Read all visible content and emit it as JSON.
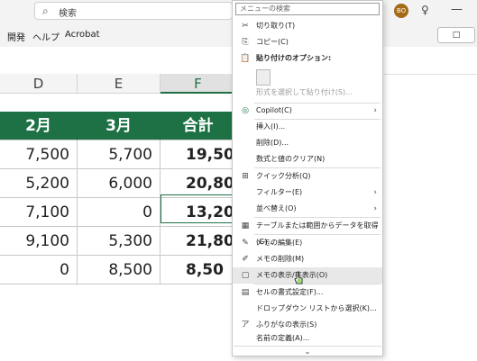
{
  "titlebar": {
    "search_placeholder": "検索",
    "avatar_initials": "BO"
  },
  "ribbon": {
    "tabs": [
      "開発",
      "ヘルプ",
      "Acrobat"
    ]
  },
  "comment_button": "□",
  "columns": [
    "D",
    "E",
    "F"
  ],
  "header_row": [
    "2月",
    "3月",
    "合計"
  ],
  "rows": [
    [
      "7,500",
      "5,700",
      "19,50"
    ],
    [
      "5,200",
      "6,000",
      "20,80"
    ],
    [
      "7,100",
      "0",
      "13,20"
    ],
    [
      "9,100",
      "5,300",
      "21,80"
    ],
    [
      "0",
      "8,500",
      "8,50"
    ]
  ],
  "menu": {
    "search_placeholder": "メニューの検索",
    "items": {
      "cut": "切り取り(T)",
      "copy": "コピー(C)",
      "paste_options": "貼り付けのオプション:",
      "paste_special": "形式を選択して貼り付け(S)...",
      "copilot": "Copilot(C)",
      "insert": "挿入(I)...",
      "delete": "削除(D)...",
      "clear": "数式と値のクリア(N)",
      "quick_analysis": "クイック分析(Q)",
      "filter": "フィルター(E)",
      "sort": "並べ替え(O)",
      "get_data": "テーブルまたは範囲からデータを取得(G)...",
      "edit_note": "メモの編集(E)",
      "delete_note": "メモの削除(M)",
      "show_hide_note": "メモの表示/非表示(O)",
      "format_cells": "セルの書式設定(F)...",
      "dropdown": "ドロップダウン リストから選択(K)...",
      "phonetic": "ふりがなの表示(S)",
      "define_name": "名前の定義(A)..."
    },
    "more": "⌄"
  },
  "colors": {
    "header_green": "#1e7145",
    "accent": "#1e7145"
  }
}
